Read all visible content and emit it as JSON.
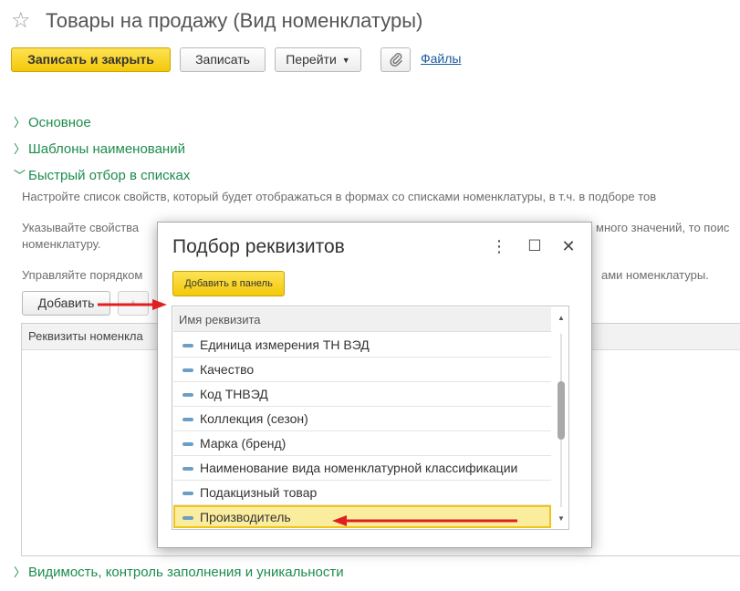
{
  "header": {
    "title": "Товары на продажу (Вид номенклатуры)",
    "favorite_icon": "star-icon"
  },
  "toolbar": {
    "save_close_label": "Записать и закрыть",
    "save_label": "Записать",
    "goto_label": "Перейти",
    "goto_caret": "▼",
    "attach_icon": "paperclip-icon",
    "files_label": "Файлы"
  },
  "groups": {
    "main": "Основное",
    "templates": "Шаблоны наименований",
    "quick_filter": "Быстрый отбор в списках",
    "visibility": "Видимость, контроль заполнения и уникальности",
    "collapsed_chevron": "〉",
    "expanded_chevron": "﹀"
  },
  "quick_filter": {
    "hint_1": "Настройте список свойств, который будет отображаться в формах со списками номенклатуры, в т.ч. в подборе тов",
    "hint_2a": "Указывайте свойства",
    "hint_2b": "много значений, то поис",
    "hint_2c": "номенклатуру.",
    "hint_3a": "Управляйте порядком",
    "hint_3b": "ами номенклатуры.",
    "add_label": "Добавить",
    "up_glyph": "▲",
    "table_header": "Реквизиты номенкла"
  },
  "dialog": {
    "title": "Подбор реквизитов",
    "more_glyph": "⋮",
    "maximize_glyph": "☐",
    "close_glyph": "✕",
    "add_to_panel_label": "Добавить в панель",
    "list_header": "Имя реквизита",
    "items": [
      "Единица измерения ТН ВЭД",
      "Качество",
      "Код ТНВЭД",
      "Коллекция (сезон)",
      "Марка (бренд)",
      "Наименование вида номенклатурной классификации",
      "Подакцизный товар",
      "Производитель"
    ],
    "selected_item": "Производитель",
    "scroll_up": "▲",
    "scroll_down": "▼"
  },
  "colors": {
    "accent_yellow": "#f4c90a",
    "group_green": "#1d8c4d",
    "link_blue": "#1a5a9a",
    "annotation_red": "#e02020",
    "selection_fill": "#fbed9e"
  }
}
